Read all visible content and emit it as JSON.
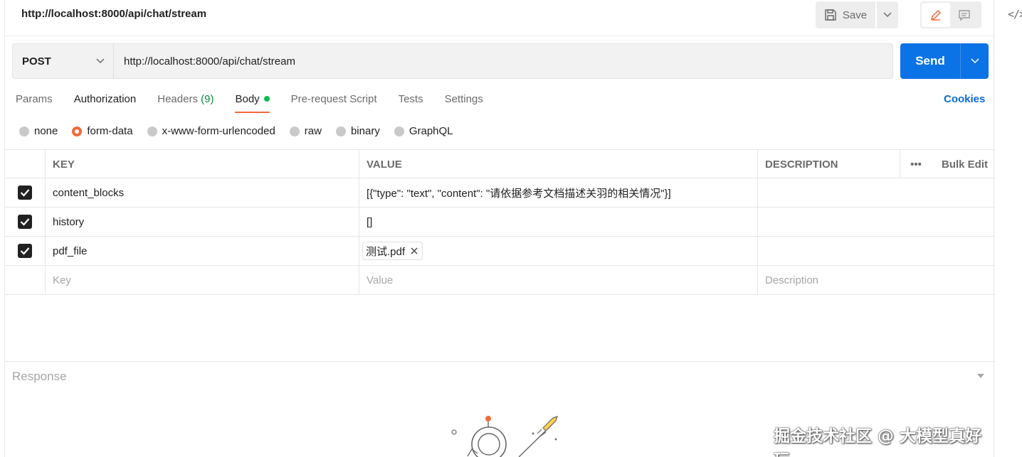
{
  "header": {
    "title_url": "http://localhost:8000/api/chat/stream",
    "save_label": "Save"
  },
  "request": {
    "method": "POST",
    "url": "http://localhost:8000/api/chat/stream",
    "send_label": "Send"
  },
  "tabs": {
    "params": "Params",
    "authorization": "Authorization",
    "headers": "Headers",
    "headers_count": "(9)",
    "body": "Body",
    "prerequest": "Pre-request Script",
    "tests": "Tests",
    "settings": "Settings",
    "cookies": "Cookies"
  },
  "body_modes": {
    "none": "none",
    "form_data": "form-data",
    "urlencoded": "x-www-form-urlencoded",
    "raw": "raw",
    "binary": "binary",
    "graphql": "GraphQL",
    "selected": "form-data"
  },
  "table": {
    "headers": {
      "key": "KEY",
      "value": "VALUE",
      "description": "DESCRIPTION",
      "more": "•••",
      "bulk_edit": "Bulk Edit"
    },
    "rows": [
      {
        "key": "content_blocks",
        "value": "[{\"type\": \"text\", \"content\": \"请依据参考文档描述关羽的相关情况\"}]",
        "checked": true
      },
      {
        "key": "history",
        "value": "[]",
        "checked": true
      },
      {
        "key": "pdf_file",
        "value": "测试.pdf",
        "checked": true
      }
    ],
    "placeholders": {
      "key": "Key",
      "value": "Value",
      "description": "Description"
    }
  },
  "response": {
    "label": "Response"
  },
  "watermark": "掘金技术社区 @ 大模型真好玩",
  "colors": {
    "accent": "#f26b3a",
    "send": "#0b73e5",
    "link": "#0b6bd8",
    "active_dot": "#0cbb52"
  }
}
